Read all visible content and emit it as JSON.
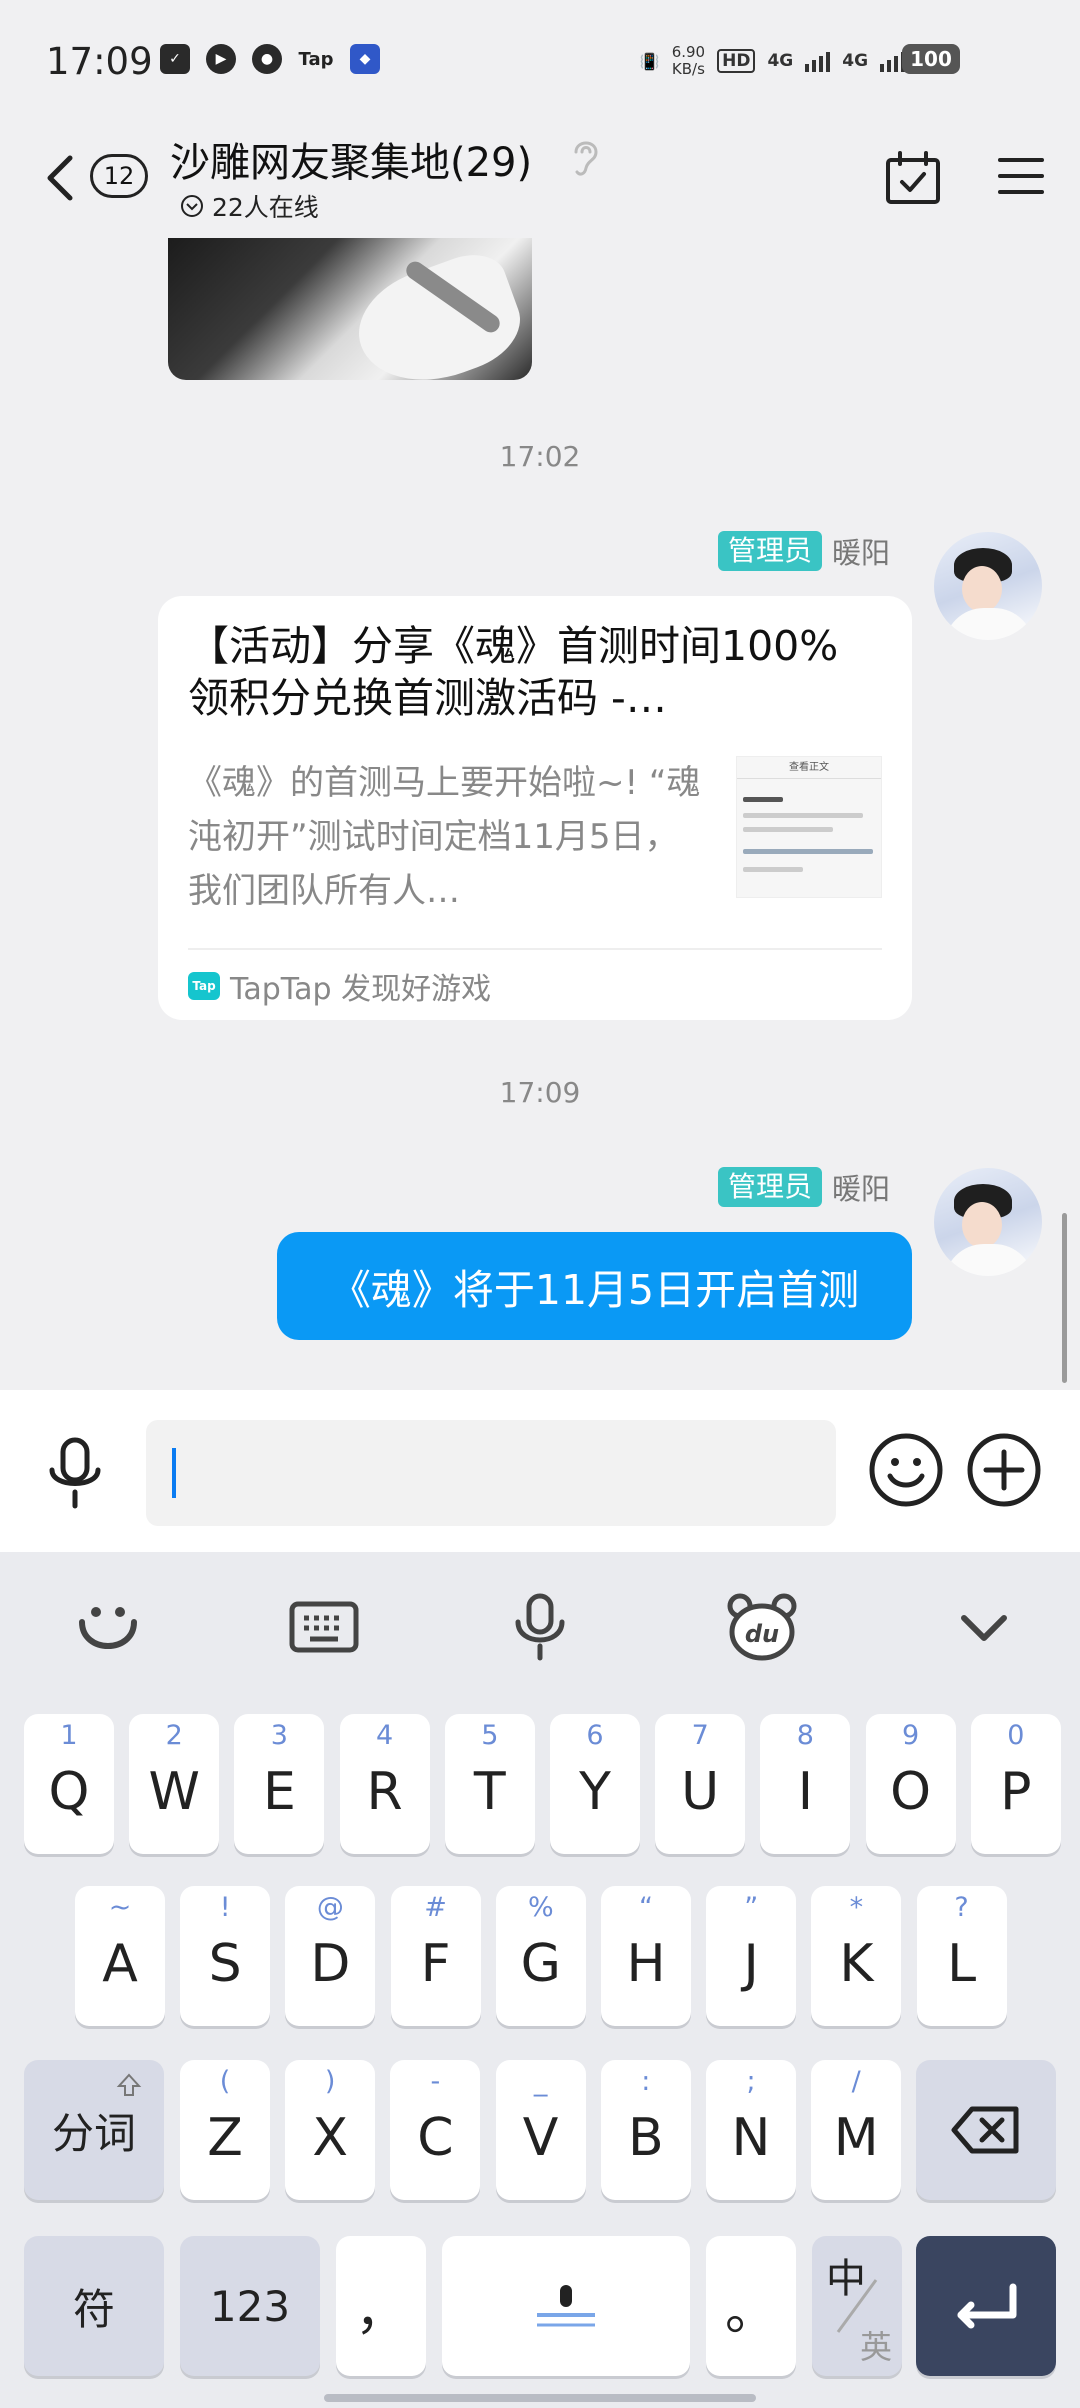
{
  "status_bar": {
    "time": "17:09",
    "left_icons": [
      "task-icon",
      "play-icon",
      "wechat-icon",
      "Tap",
      "app-icon"
    ],
    "speed_value": "6.90",
    "speed_unit": "KB/s",
    "hd": "HD",
    "signal_1": "4G",
    "signal_2": "4G",
    "battery": "100"
  },
  "header": {
    "unread_count": "12",
    "title": "沙雕网友聚集地(29)",
    "online": "22人在线"
  },
  "messages": {
    "timestamp_1": "17:02",
    "timestamp_2": "17:09",
    "sender_role": "管理员",
    "sender_name": "暖阳",
    "card": {
      "title": "【活动】分享《魂》首测时间100%领积分兑换首测激活码 -…",
      "description": "《魂》的首测马上要开始啦~! “魂沌初开”测试时间定档11月5日，我们团队所有人…",
      "thumb_heading": "查看正文",
      "source_logo": "Tap",
      "source": "TapTap 发现好游戏"
    },
    "text_bubble": "《魂》将于11月5日开启首测"
  },
  "input": {
    "value": "",
    "placeholder": ""
  },
  "keyboard": {
    "row1": [
      {
        "k": "Q",
        "s": "1"
      },
      {
        "k": "W",
        "s": "2"
      },
      {
        "k": "E",
        "s": "3"
      },
      {
        "k": "R",
        "s": "4"
      },
      {
        "k": "T",
        "s": "5"
      },
      {
        "k": "Y",
        "s": "6"
      },
      {
        "k": "U",
        "s": "7"
      },
      {
        "k": "I",
        "s": "8"
      },
      {
        "k": "O",
        "s": "9"
      },
      {
        "k": "P",
        "s": "0"
      }
    ],
    "row2": [
      {
        "k": "A",
        "s": "~"
      },
      {
        "k": "S",
        "s": "!"
      },
      {
        "k": "D",
        "s": "@"
      },
      {
        "k": "F",
        "s": "#"
      },
      {
        "k": "G",
        "s": "%"
      },
      {
        "k": "H",
        "s": "“"
      },
      {
        "k": "J",
        "s": "”"
      },
      {
        "k": "K",
        "s": "*"
      },
      {
        "k": "L",
        "s": "?"
      }
    ],
    "row3": [
      {
        "k": "Z",
        "s": "("
      },
      {
        "k": "X",
        "s": ")"
      },
      {
        "k": "C",
        "s": "-"
      },
      {
        "k": "V",
        "s": "_"
      },
      {
        "k": "B",
        "s": ":"
      },
      {
        "k": "N",
        "s": ";"
      },
      {
        "k": "M",
        "s": "/"
      }
    ],
    "split_key": "分词",
    "symbol_key": "符",
    "num_key": "123",
    "comma_key": "，",
    "period_key": "。",
    "lang_primary": "中",
    "lang_secondary": "英"
  },
  "colors": {
    "accent": "#0a99f5",
    "role_badge": "#3ac4c4",
    "enter_key": "#3a4560"
  }
}
